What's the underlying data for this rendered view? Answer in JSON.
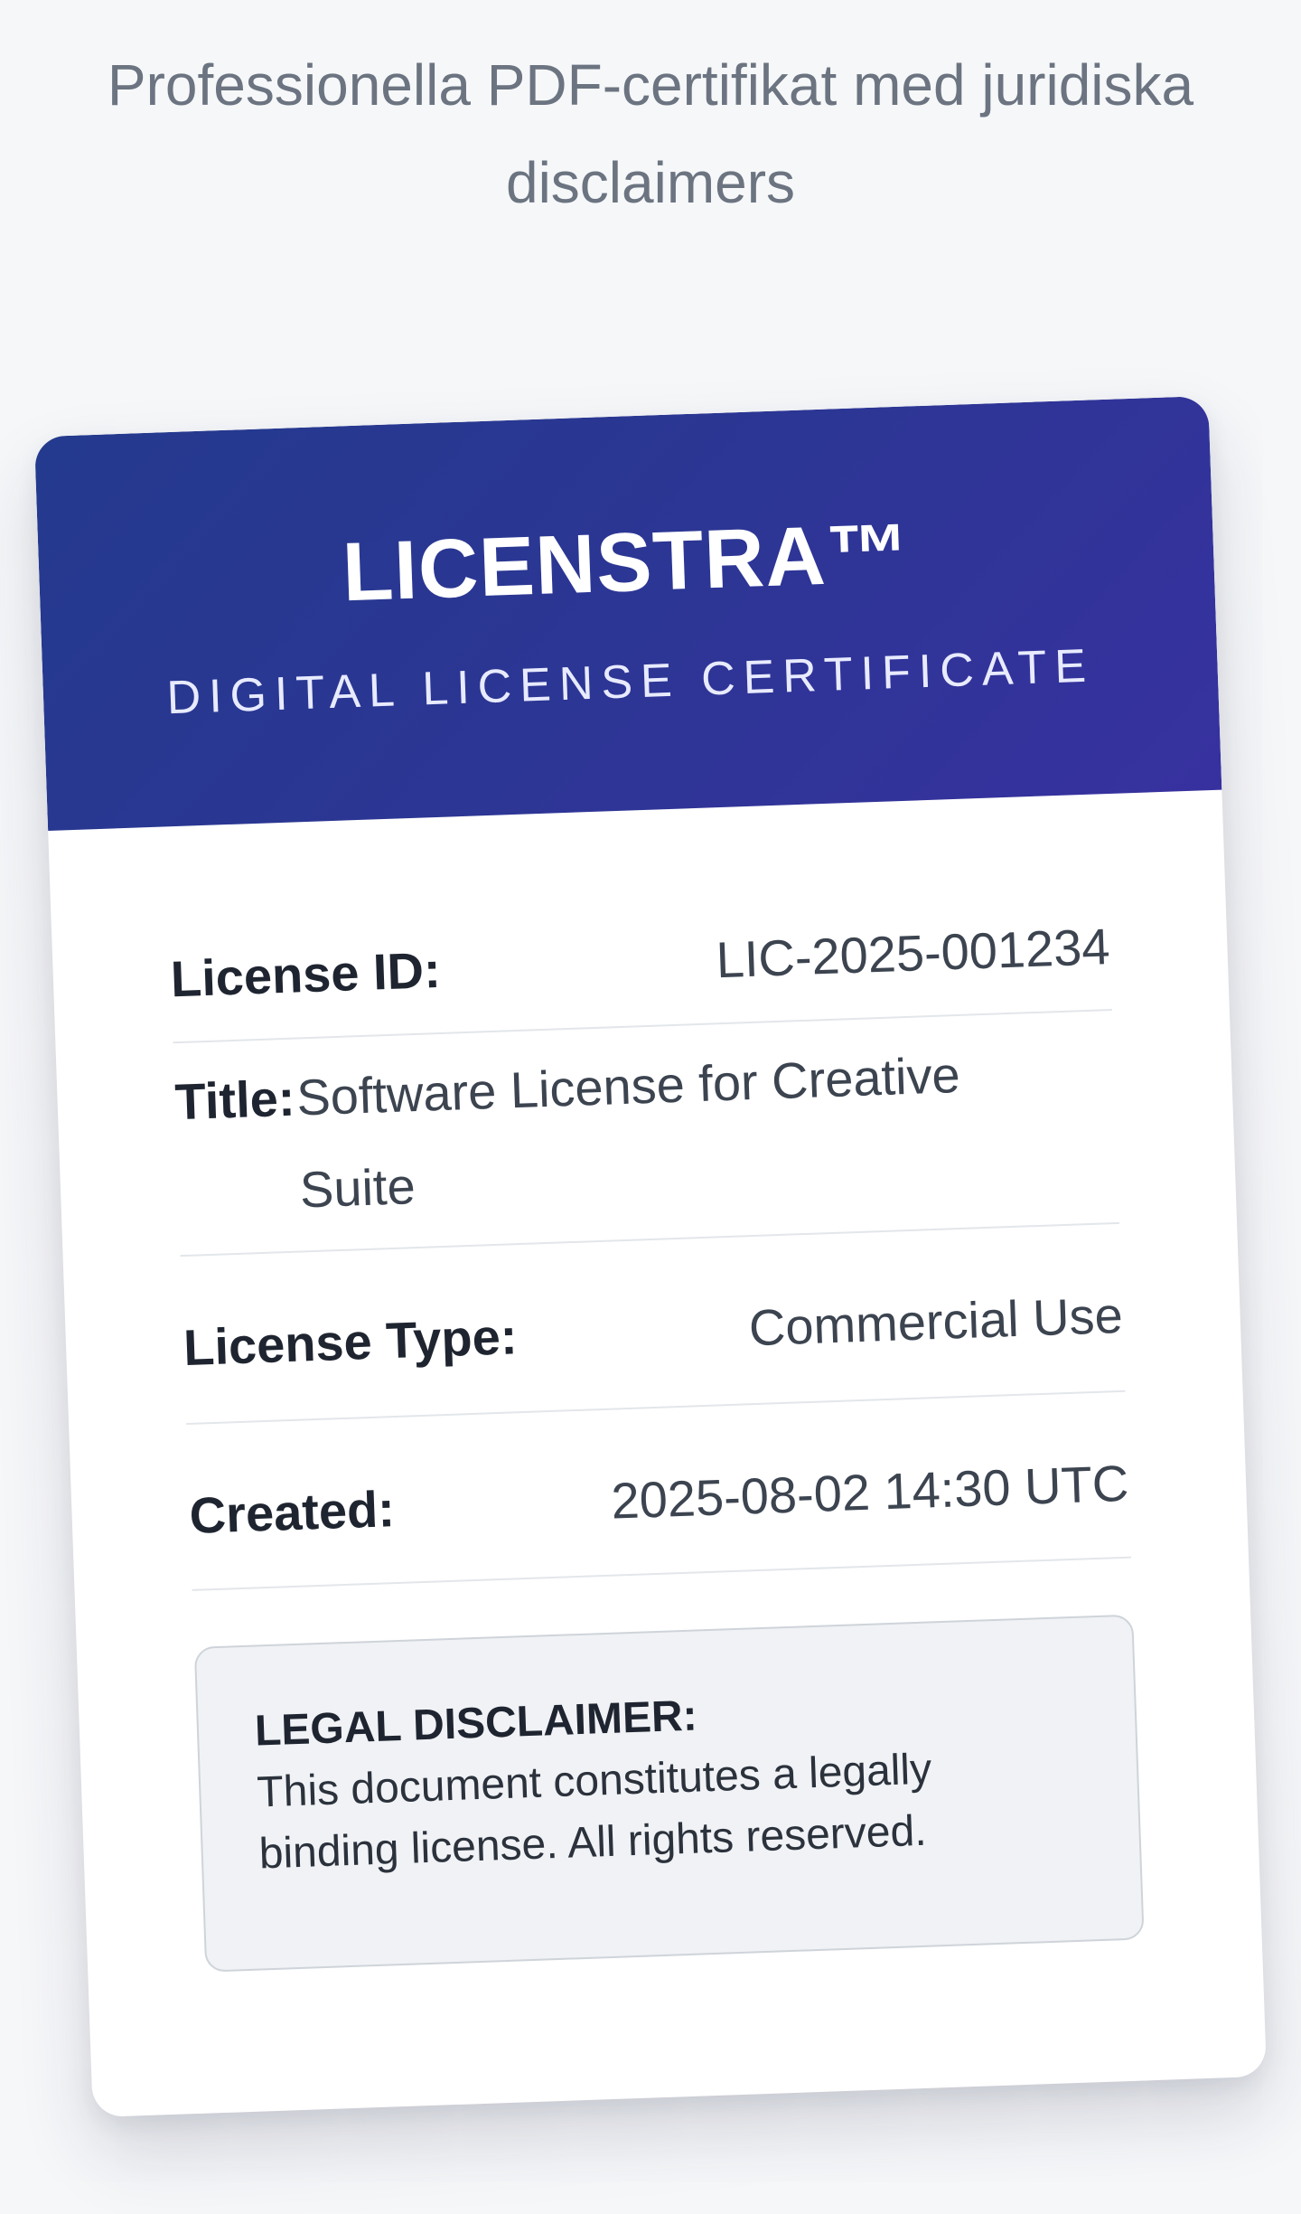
{
  "page": {
    "subtitle": "Professionella PDF-certifikat med juridiska disclaimers"
  },
  "certificate": {
    "brand": "LICENSTRA™",
    "tagline": "DIGITAL LICENSE CERTIFICATE",
    "fields": {
      "license_id": {
        "label": "License ID:",
        "value": "LIC-2025-001234"
      },
      "title": {
        "label": "Title:",
        "value": "Software License for Creative Suite"
      },
      "license_type": {
        "label": "License Type:",
        "value": "Commercial Use"
      },
      "created": {
        "label": "Created:",
        "value": "2025-08-02 14:30 UTC"
      }
    },
    "disclaimer": {
      "title": "LEGAL DISCLAIMER:",
      "text": "This document constitutes a legally binding license. All rights reserved."
    }
  },
  "colors": {
    "header_gradient_start": "#243a8e",
    "header_gradient_end": "#37319f",
    "page_background": "#f6f7f9",
    "card_background": "#ffffff",
    "disclaimer_background": "#f0f2f5"
  }
}
